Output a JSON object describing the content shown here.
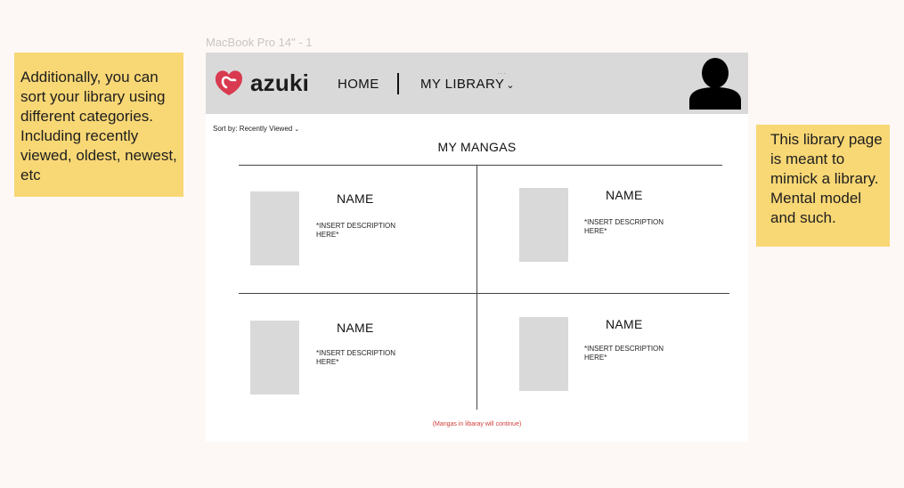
{
  "canvas": {
    "frame_label": "MacBook Pro 14\" - 1"
  },
  "notes": {
    "left": "Additionally, you can sort your library using different categories. Including recently viewed, oldest, newest, etc",
    "right": "This library page is meant to mimick a library. Mental model and such."
  },
  "navbar": {
    "brand": "azuki",
    "home_label": "HOME",
    "library_label": "MY LIBRARY",
    "dots": "···"
  },
  "sort": {
    "label": "Sort by: Recently Viewed"
  },
  "section": {
    "title": "MY MANGAS"
  },
  "cards": [
    {
      "name": "NAME",
      "description": "*INSERT DESCRIPTION HERE*"
    },
    {
      "name": "NAME",
      "description": "*INSERT DESCRIPTION HERE*"
    },
    {
      "name": "NAME",
      "description": "*INSERT DESCRIPTION HERE*"
    },
    {
      "name": "NAME",
      "description": "*INSERT DESCRIPTION HERE*"
    }
  ],
  "footer": {
    "continue_note": "(Mangas in libaray will continue)"
  },
  "colors": {
    "note": "#f8d775",
    "navbar": "#d9d9d9",
    "placeholder": "#d9d9d9",
    "logo": "#d93a4f",
    "continue_note": "#d0403c"
  },
  "icons": {
    "logo": "azuki-heart-logo-icon",
    "avatar": "user-avatar-icon",
    "caret": "chevron-down-icon"
  }
}
